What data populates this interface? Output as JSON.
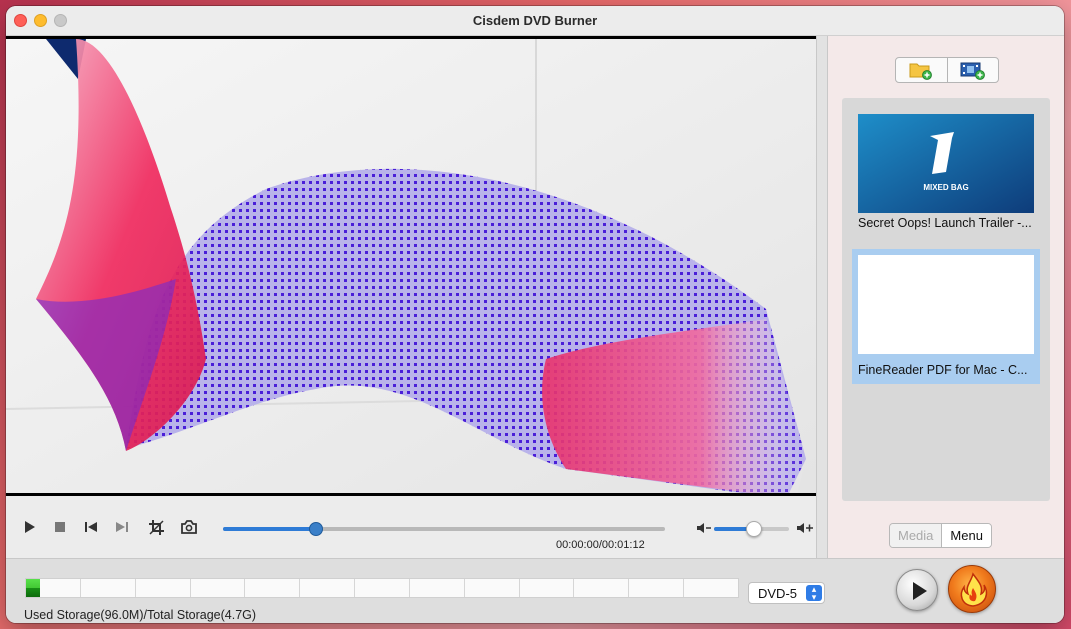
{
  "window": {
    "title": "Cisdem DVD Burner"
  },
  "player": {
    "timecode": "00:00:00/00:01:12",
    "progress_fraction": 0.21,
    "volume_fraction": 0.53
  },
  "media_list": {
    "items": [
      {
        "label": "Secret Oops! Launch Trailer -...",
        "thumb_text": "MIXED BAG",
        "selected": false
      },
      {
        "label": "FineReader PDF for Mac - C...",
        "selected": true
      }
    ]
  },
  "tabs": {
    "media": "Media",
    "menu": "Menu"
  },
  "storage": {
    "text": "Used Storage(96.0M)/Total Storage(4.7G)",
    "used_fraction": 0.02
  },
  "disc": {
    "selected": "DVD-5"
  },
  "icons": {
    "add_folder": "folder-add-icon",
    "add_video": "film-add-icon",
    "play": "play-icon",
    "stop": "stop-icon",
    "prev": "previous-icon",
    "next": "next-icon",
    "crop": "crop-icon",
    "snapshot": "camera-icon",
    "vol_down": "volume-down-icon",
    "vol_up": "volume-up-icon",
    "burn": "flame-icon"
  },
  "colors": {
    "accent": "#2e7bd6",
    "selection": "#a9cdf0"
  }
}
